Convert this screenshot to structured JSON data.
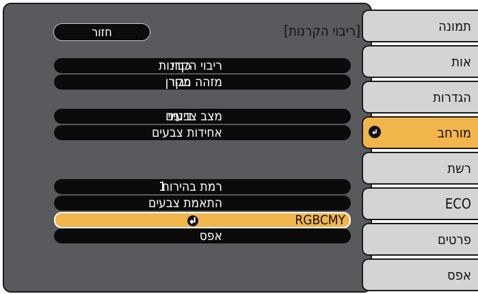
{
  "sidebar": {
    "items": [
      {
        "label": "תמונה"
      },
      {
        "label": "אות"
      },
      {
        "label": "הגדרות"
      },
      {
        "label": "מורחב",
        "active": true
      },
      {
        "label": "רשת"
      },
      {
        "label": "ECO"
      },
      {
        "label": "פרטים"
      },
      {
        "label": "אפס"
      }
    ]
  },
  "header": {
    "title": "[ריבוי הקרנות]",
    "back_label": "חזור"
  },
  "rows": [
    {
      "label": "ריבוי הקרנות",
      "value": "כבוי"
    },
    {
      "label": "מזהה מקרן",
      "value": "כבוי"
    },
    {
      "label": "מצב צבעים",
      "value": "דינמי"
    },
    {
      "label": "אחידות צבעים",
      "value": ""
    },
    {
      "label": "רמת בהירות",
      "value": "1"
    },
    {
      "label": "התאמת צבעים",
      "value": ""
    },
    {
      "label": "RGBCMY",
      "value": "",
      "selected": true
    },
    {
      "label": "אפס",
      "value": ""
    }
  ],
  "colors": {
    "panel_bg": "#585a5e",
    "pill_bg": "#0b0b0b",
    "accent": "#f1b54b",
    "sidebar_bg": "#d3d4d3"
  }
}
